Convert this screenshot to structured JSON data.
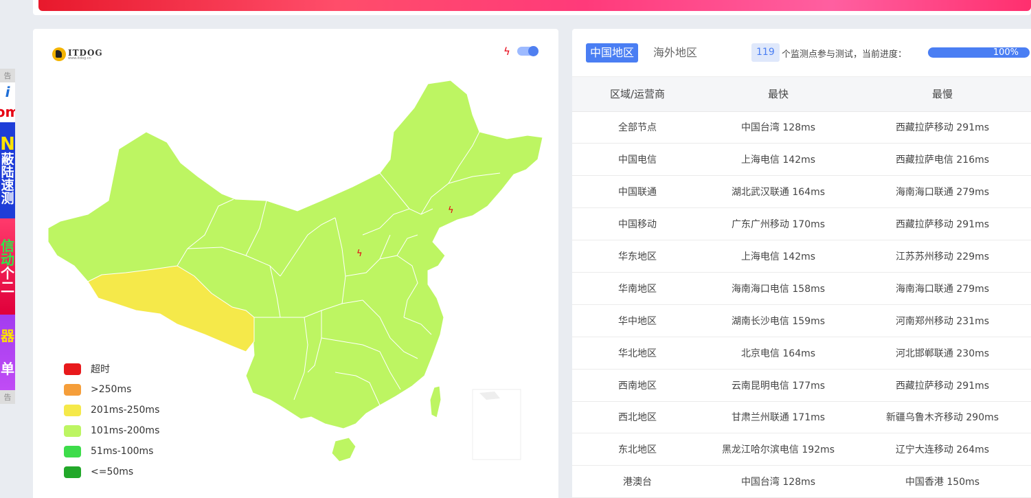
{
  "logo": {
    "name": "ITDOG",
    "sub": "www.itdog.cn"
  },
  "map_controls": {
    "lightning_icon": "lightning-icon",
    "toggle_on": true
  },
  "map": {
    "region_colors": {
      "default": "#bdf562",
      "xizang": "#f5e94a",
      "border": "#ffffff"
    }
  },
  "legend": [
    {
      "label": "超时",
      "color": "#e8191c"
    },
    {
      "label": ">250ms",
      "color": "#f59e3a"
    },
    {
      "label": "201ms-250ms",
      "color": "#f5e94a"
    },
    {
      "label": "101ms-200ms",
      "color": "#bdf562"
    },
    {
      "label": "51ms-100ms",
      "color": "#3ddc4a"
    },
    {
      "label": "<=50ms",
      "color": "#22a82a"
    }
  ],
  "tabs": [
    {
      "label": "中国地区",
      "active": true
    },
    {
      "label": "海外地区",
      "active": false
    }
  ],
  "monitor": {
    "count": "119",
    "text": "个监测点参与测试，当前进度：",
    "progress": "100%",
    "progress_value": 1.0
  },
  "table": {
    "headers": [
      "区域/运营商",
      "最快",
      "最慢"
    ],
    "rows": [
      [
        "全部节点",
        "中国台湾 128ms",
        "西藏拉萨移动 291ms"
      ],
      [
        "中国电信",
        "上海电信 142ms",
        "西藏拉萨电信 216ms"
      ],
      [
        "中国联通",
        "湖北武汉联通 164ms",
        "海南海口联通 279ms"
      ],
      [
        "中国移动",
        "广东广州移动 170ms",
        "西藏拉萨移动 291ms"
      ],
      [
        "华东地区",
        "上海电信 142ms",
        "江苏苏州移动 229ms"
      ],
      [
        "华南地区",
        "海南海口电信 158ms",
        "海南海口联通 279ms"
      ],
      [
        "华中地区",
        "湖南长沙电信 159ms",
        "河南郑州移动 231ms"
      ],
      [
        "华北地区",
        "北京电信 164ms",
        "河北邯郸联通 230ms"
      ],
      [
        "西南地区",
        "云南昆明电信 177ms",
        "西藏拉萨移动 291ms"
      ],
      [
        "西北地区",
        "甘肃兰州联通 171ms",
        "新疆乌鲁木齐移动 290ms"
      ],
      [
        "东北地区",
        "黑龙江哈尔滨电信 192ms",
        "辽宁大连移动 264ms"
      ],
      [
        "港澳台",
        "中国台湾 128ms",
        "中国香港 150ms"
      ]
    ]
  },
  "side_ad": {
    "label_top": "告",
    "label_bottom": "告"
  }
}
